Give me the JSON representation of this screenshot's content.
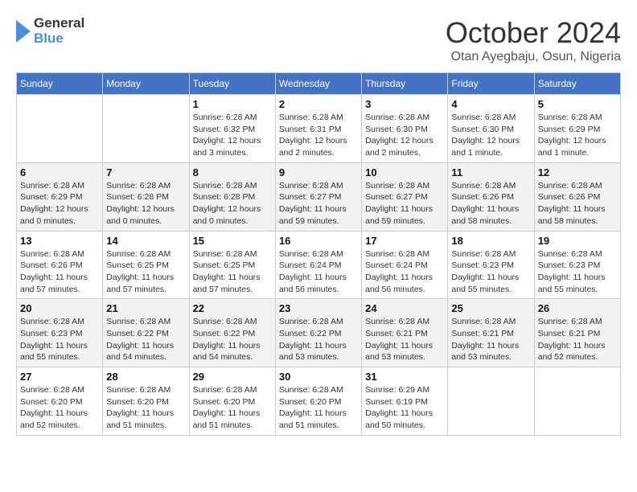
{
  "header": {
    "logo_line1": "General",
    "logo_line2": "Blue",
    "month": "October 2024",
    "location": "Otan Ayegbaju, Osun, Nigeria"
  },
  "weekdays": [
    "Sunday",
    "Monday",
    "Tuesday",
    "Wednesday",
    "Thursday",
    "Friday",
    "Saturday"
  ],
  "weeks": [
    [
      {
        "day": "",
        "info": ""
      },
      {
        "day": "",
        "info": ""
      },
      {
        "day": "1",
        "info": "Sunrise: 6:28 AM\nSunset: 6:32 PM\nDaylight: 12 hours and 3 minutes."
      },
      {
        "day": "2",
        "info": "Sunrise: 6:28 AM\nSunset: 6:31 PM\nDaylight: 12 hours and 2 minutes."
      },
      {
        "day": "3",
        "info": "Sunrise: 6:28 AM\nSunset: 6:30 PM\nDaylight: 12 hours and 2 minutes."
      },
      {
        "day": "4",
        "info": "Sunrise: 6:28 AM\nSunset: 6:30 PM\nDaylight: 12 hours and 1 minute."
      },
      {
        "day": "5",
        "info": "Sunrise: 6:28 AM\nSunset: 6:29 PM\nDaylight: 12 hours and 1 minute."
      }
    ],
    [
      {
        "day": "6",
        "info": "Sunrise: 6:28 AM\nSunset: 6:29 PM\nDaylight: 12 hours and 0 minutes."
      },
      {
        "day": "7",
        "info": "Sunrise: 6:28 AM\nSunset: 6:28 PM\nDaylight: 12 hours and 0 minutes."
      },
      {
        "day": "8",
        "info": "Sunrise: 6:28 AM\nSunset: 6:28 PM\nDaylight: 12 hours and 0 minutes."
      },
      {
        "day": "9",
        "info": "Sunrise: 6:28 AM\nSunset: 6:27 PM\nDaylight: 11 hours and 59 minutes."
      },
      {
        "day": "10",
        "info": "Sunrise: 6:28 AM\nSunset: 6:27 PM\nDaylight: 11 hours and 59 minutes."
      },
      {
        "day": "11",
        "info": "Sunrise: 6:28 AM\nSunset: 6:26 PM\nDaylight: 11 hours and 58 minutes."
      },
      {
        "day": "12",
        "info": "Sunrise: 6:28 AM\nSunset: 6:26 PM\nDaylight: 11 hours and 58 minutes."
      }
    ],
    [
      {
        "day": "13",
        "info": "Sunrise: 6:28 AM\nSunset: 6:26 PM\nDaylight: 11 hours and 57 minutes."
      },
      {
        "day": "14",
        "info": "Sunrise: 6:28 AM\nSunset: 6:25 PM\nDaylight: 11 hours and 57 minutes."
      },
      {
        "day": "15",
        "info": "Sunrise: 6:28 AM\nSunset: 6:25 PM\nDaylight: 11 hours and 57 minutes."
      },
      {
        "day": "16",
        "info": "Sunrise: 6:28 AM\nSunset: 6:24 PM\nDaylight: 11 hours and 56 minutes."
      },
      {
        "day": "17",
        "info": "Sunrise: 6:28 AM\nSunset: 6:24 PM\nDaylight: 11 hours and 56 minutes."
      },
      {
        "day": "18",
        "info": "Sunrise: 6:28 AM\nSunset: 6:23 PM\nDaylight: 11 hours and 55 minutes."
      },
      {
        "day": "19",
        "info": "Sunrise: 6:28 AM\nSunset: 6:23 PM\nDaylight: 11 hours and 55 minutes."
      }
    ],
    [
      {
        "day": "20",
        "info": "Sunrise: 6:28 AM\nSunset: 6:23 PM\nDaylight: 11 hours and 55 minutes."
      },
      {
        "day": "21",
        "info": "Sunrise: 6:28 AM\nSunset: 6:22 PM\nDaylight: 11 hours and 54 minutes."
      },
      {
        "day": "22",
        "info": "Sunrise: 6:28 AM\nSunset: 6:22 PM\nDaylight: 11 hours and 54 minutes."
      },
      {
        "day": "23",
        "info": "Sunrise: 6:28 AM\nSunset: 6:22 PM\nDaylight: 11 hours and 53 minutes."
      },
      {
        "day": "24",
        "info": "Sunrise: 6:28 AM\nSunset: 6:21 PM\nDaylight: 11 hours and 53 minutes."
      },
      {
        "day": "25",
        "info": "Sunrise: 6:28 AM\nSunset: 6:21 PM\nDaylight: 11 hours and 53 minutes."
      },
      {
        "day": "26",
        "info": "Sunrise: 6:28 AM\nSunset: 6:21 PM\nDaylight: 11 hours and 52 minutes."
      }
    ],
    [
      {
        "day": "27",
        "info": "Sunrise: 6:28 AM\nSunset: 6:20 PM\nDaylight: 11 hours and 52 minutes."
      },
      {
        "day": "28",
        "info": "Sunrise: 6:28 AM\nSunset: 6:20 PM\nDaylight: 11 hours and 51 minutes."
      },
      {
        "day": "29",
        "info": "Sunrise: 6:28 AM\nSunset: 6:20 PM\nDaylight: 11 hours and 51 minutes."
      },
      {
        "day": "30",
        "info": "Sunrise: 6:28 AM\nSunset: 6:20 PM\nDaylight: 11 hours and 51 minutes."
      },
      {
        "day": "31",
        "info": "Sunrise: 6:29 AM\nSunset: 6:19 PM\nDaylight: 11 hours and 50 minutes."
      },
      {
        "day": "",
        "info": ""
      },
      {
        "day": "",
        "info": ""
      }
    ]
  ]
}
